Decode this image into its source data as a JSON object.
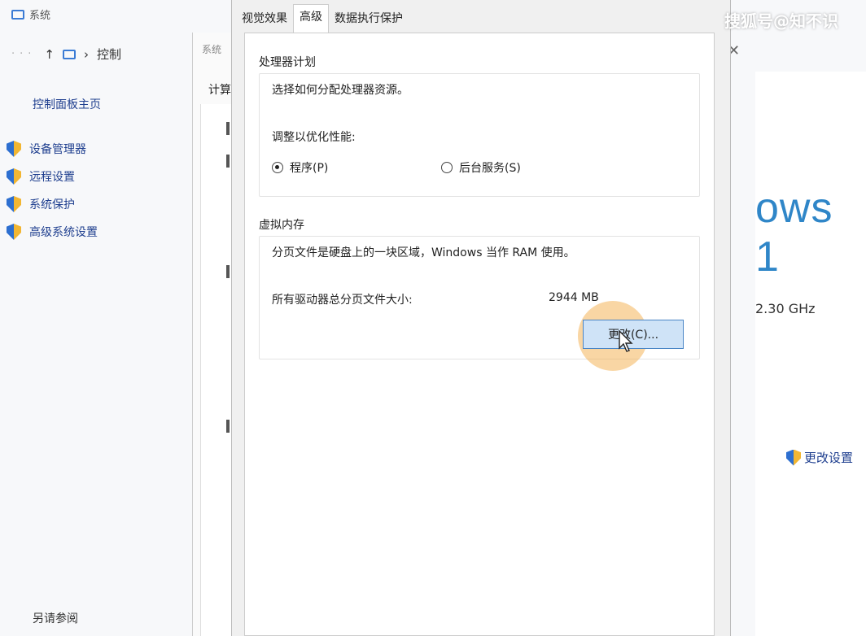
{
  "system_window": {
    "title": "系统",
    "address_crumb": "控制",
    "sidebar_home": "控制面板主页",
    "sidebar_items": [
      "设备管理器",
      "远程设置",
      "系统保护",
      "高级系统设置"
    ],
    "see_also": "另请参阅",
    "logo_fragment": "ows 1",
    "cpu_fragment": "2.30 GHz",
    "change_settings": "更改设置"
  },
  "mid_dialog": {
    "title": "系统",
    "tab_fragment": "计算"
  },
  "perf_dialog": {
    "tabs": [
      {
        "label": "视觉效果",
        "active": false
      },
      {
        "label": "高级",
        "active": true
      },
      {
        "label": "数据执行保护",
        "active": false
      }
    ],
    "processor": {
      "group_title": "处理器计划",
      "description": "选择如何分配处理器资源。",
      "adjust_label": "调整以优化性能:",
      "options": [
        {
          "label": "程序(P)",
          "selected": true
        },
        {
          "label": "后台服务(S)",
          "selected": false
        }
      ]
    },
    "virtual_memory": {
      "group_title": "虚拟内存",
      "description": "分页文件是硬盘上的一块区域，Windows 当作 RAM 使用。",
      "total_label": "所有驱动器总分页文件大小:",
      "total_value": "2944 MB",
      "change_button": "更改(C)..."
    }
  },
  "watermark": "搜狐号@知不识"
}
